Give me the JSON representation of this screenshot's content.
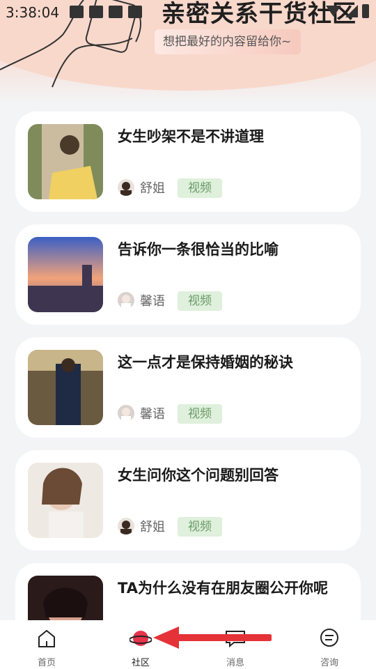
{
  "status_bar": {
    "time": "3:38:04"
  },
  "header": {
    "title": "亲密关系干货社区",
    "subtitle": "想把最好的内容留给你~"
  },
  "articles": [
    {
      "title": "女生吵架不是不讲道理",
      "author": "舒姐",
      "tag": "视频"
    },
    {
      "title": "告诉你一条很恰当的比喻",
      "author": "馨语",
      "tag": "视频"
    },
    {
      "title": "这一点才是保持婚姻的秘诀",
      "author": "馨语",
      "tag": "视频"
    },
    {
      "title": "女生问你这个问题别回答",
      "author": "舒姐",
      "tag": "视频"
    },
    {
      "title": "TA为什么没有在朋友圈公开你呢"
    }
  ],
  "tabbar": {
    "tabs": [
      {
        "label": "首页",
        "icon": "home-icon"
      },
      {
        "label": "社区",
        "icon": "planet-icon",
        "active": true
      },
      {
        "label": "消息",
        "icon": "message-icon"
      },
      {
        "label": "咨询",
        "icon": "chat-icon"
      }
    ]
  },
  "colors": {
    "tag_bg": "#dff0dc",
    "tag_text": "#6a9a67",
    "arrow": "#e53238",
    "planet": "#e5334b"
  }
}
